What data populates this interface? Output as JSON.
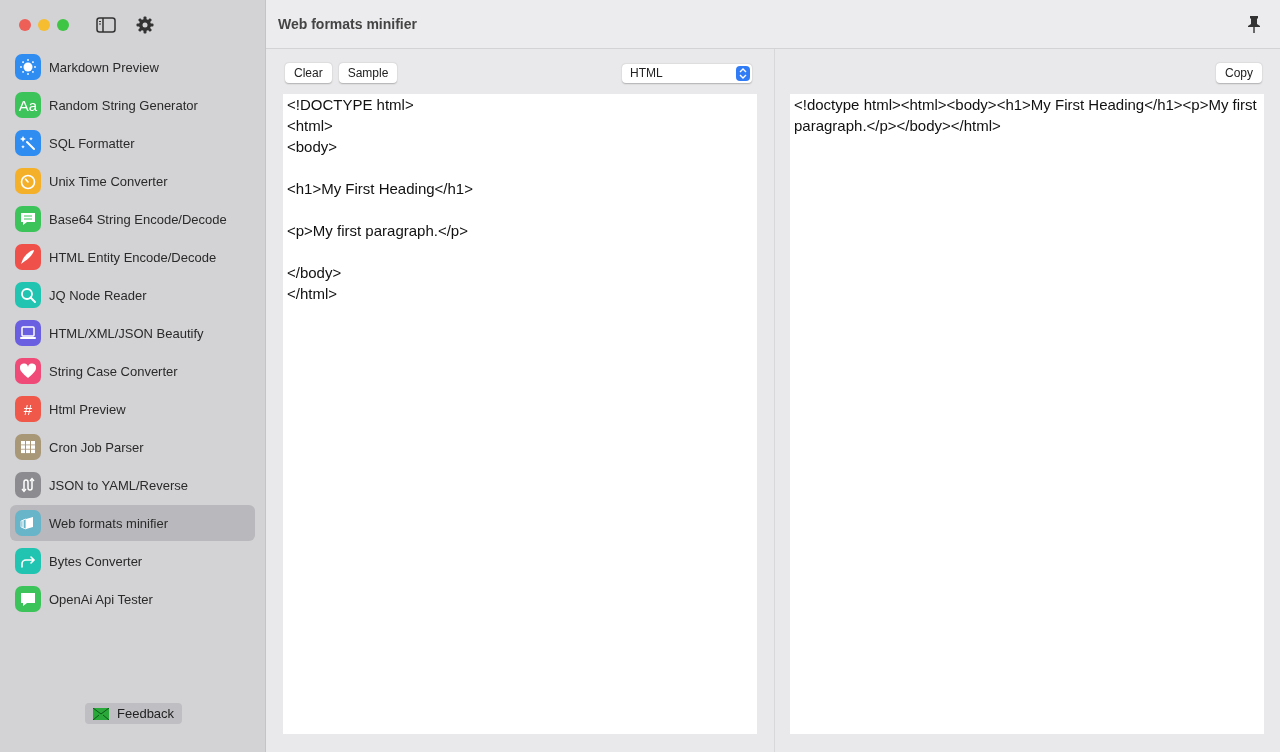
{
  "window": {
    "title": "Web formats minifier"
  },
  "sidebar": {
    "items": [
      {
        "label": "Markdown Preview",
        "kind": "sun",
        "color": "#2f8cf0",
        "selected": false
      },
      {
        "label": "Random String Generator",
        "kind": "text",
        "glyph": "Aa",
        "color": "#3cc45a",
        "selected": false
      },
      {
        "label": "SQL Formatter",
        "kind": "wand",
        "color": "#2f8cf0",
        "selected": false
      },
      {
        "label": "Unix Time Converter",
        "kind": "timer",
        "color": "#f5b02a",
        "selected": false
      },
      {
        "label": "Base64 String Encode/Decode",
        "kind": "chat",
        "color": "#3cc45a",
        "selected": false
      },
      {
        "label": "HTML Entity Encode/Decode",
        "kind": "pen",
        "color": "#f0504a",
        "selected": false
      },
      {
        "label": "JQ Node Reader",
        "kind": "search",
        "color": "#20c4b0",
        "selected": false
      },
      {
        "label": "HTML/XML/JSON Beautify",
        "kind": "laptop",
        "color": "#6a5fe0",
        "selected": false
      },
      {
        "label": "String Case Converter",
        "kind": "heart",
        "color": "#f04a78",
        "selected": false
      },
      {
        "label": "Html Preview",
        "kind": "text",
        "glyph": "#",
        "color": "#f0584a",
        "selected": false
      },
      {
        "label": "Cron Job Parser",
        "kind": "grid",
        "color": "#a89878",
        "selected": false
      },
      {
        "label": "JSON to YAML/Reverse",
        "kind": "swap",
        "color": "#8c8c90",
        "selected": false
      },
      {
        "label": "Web formats minifier",
        "kind": "cube",
        "color": "#68b4c8",
        "selected": true
      },
      {
        "label": "Bytes Converter",
        "kind": "arrow",
        "color": "#20c4b0",
        "selected": false
      },
      {
        "label": "OpenAi Api Tester",
        "kind": "bubble",
        "color": "#3cc45a",
        "selected": false
      }
    ],
    "feedback": "Feedback"
  },
  "input_pane": {
    "buttons": [
      "Clear",
      "Sample"
    ],
    "format": "HTML",
    "text": "<!DOCTYPE html>\n<html>\n<body>\n\n<h1>My First Heading</h1>\n\n<p>My first paragraph.</p>\n\n</body>\n</html>"
  },
  "output_pane": {
    "button": "Copy",
    "text": "<!doctype html><html><body><h1>My First Heading</h1><p>My first paragraph.</p></body></html>"
  }
}
